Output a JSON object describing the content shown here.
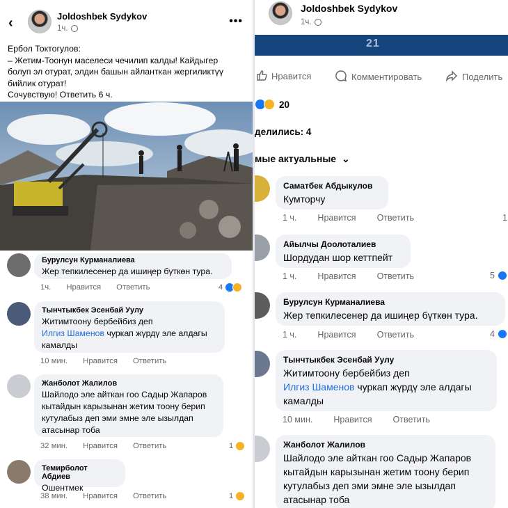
{
  "left": {
    "author": "Joldoshbek Sydykov",
    "time": "1ч.",
    "caption_lines": [
      "Ербол Токтогулов:",
      "– Жетим-Тоонун маселеси чечилип калды! Кайдыгер",
      "болуп эл отурат, элдин башын айланткан жергиликтүү",
      "бийлик отурат!",
      "Сочувствую! Ответить 6 ч."
    ],
    "comments": [
      {
        "name": "Бурулсун Курманалиева",
        "text": "Жер тепкилесенер да ишиңер бүткөн тура.",
        "time": "1ч.",
        "like": "Нравится",
        "reply": "Ответить",
        "count": "4"
      },
      {
        "name": "Тынчтыкбек Эсенбай Уулу",
        "text1": "Житимтоону бербейбиз деп",
        "link": "Илгиз Шаменов",
        "text2": " чуркап жүрдү эле алдагы",
        "text3": "камалды",
        "time": "10 мин.",
        "like": "Нравится",
        "reply": "Ответить"
      },
      {
        "name": "Жанболот Жалилов",
        "text1": "Шайлодо эле айткан гоо Садыр Жапаров",
        "text2": "кытайдын карызынан жетим тоону берип",
        "text3": "кутулабыз деп эми эмне эле ызылдап",
        "text4": "атасынар тоба",
        "time": "32 мин.",
        "like": "Нравится",
        "reply": "Ответить",
        "count": "1"
      },
      {
        "name": "Темирболот Абдиев",
        "text": "Ошентмек",
        "time": "38 мин.",
        "like": "Нравится",
        "reply": "Ответить",
        "count": "1"
      }
    ]
  },
  "right": {
    "author": "Joldoshbek Sydykov",
    "time": "1ч.",
    "banner_text": "21",
    "actions": {
      "like": "Нравится",
      "comment": "Комментировать",
      "share": "Поделить"
    },
    "reactions_count": "20",
    "shares": "делились: 4",
    "sort": "мые актуальные",
    "comments": [
      {
        "name": "Саматбек Абдыкулов",
        "text": "Кумторчу",
        "time": "1 ч.",
        "like": "Нравится",
        "reply": "Ответить",
        "count": "1"
      },
      {
        "name": "Айылчы Доолоталиев",
        "text": "Шордудан шор кеттпейт",
        "time": "1 ч.",
        "like": "Нравится",
        "reply": "Ответить",
        "count": "5"
      },
      {
        "name": "Бурулсун Курманалиева",
        "text": "Жер тепкилесенер да ишиңер бүткөн тура.",
        "time": "1 ч.",
        "like": "Нравится",
        "reply": "Ответить",
        "count": "4"
      },
      {
        "name": "Тынчтыкбек Эсенбай Уулу",
        "text1": "Житимтоону бербейбиз деп",
        "link": "Илгиз Шаменов",
        "text2": " чуркап жүрдү эле алдагы",
        "text3": "камалды",
        "time": "10 мин.",
        "like": "Нравится",
        "reply": "Ответить"
      },
      {
        "name": "Жанболот Жалилов",
        "text1": "Шайлодо эле айткан гоо Садыр Жапаров",
        "text2": "кытайдын карызынан жетим тоону берип",
        "text3": "кутулабыз деп эми эмне эле ызылдап",
        "text4": "атасынар тоба"
      }
    ]
  }
}
